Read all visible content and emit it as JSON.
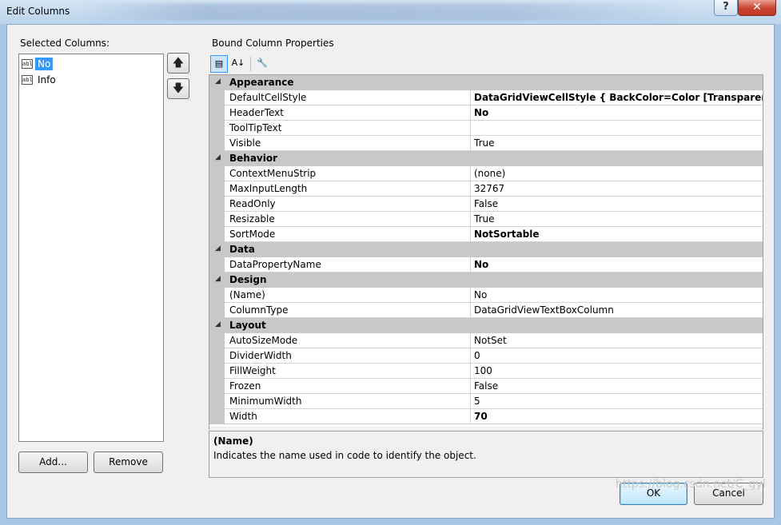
{
  "window": {
    "title": "Edit Columns",
    "help_label": "?",
    "close_label": "✕"
  },
  "left": {
    "label": "Selected Columns:",
    "items": [
      {
        "icon": "abl",
        "label": "No",
        "selected": true
      },
      {
        "icon": "abl",
        "label": "Info",
        "selected": false
      }
    ],
    "up_glyph": "🡅",
    "down_glyph": "🡇",
    "add_label": "Add...",
    "remove_label": "Remove"
  },
  "right": {
    "label": "Bound Column Properties",
    "toolbar": {
      "categorized_glyph": "▤",
      "alpha_glyph": "A↓",
      "props_glyph": "🔧"
    },
    "categories": [
      {
        "name": "Appearance",
        "props": [
          {
            "name": "DefaultCellStyle",
            "value": "DataGridViewCellStyle { BackColor=Color [Transparent] }",
            "bold": true
          },
          {
            "name": "HeaderText",
            "value": "No",
            "bold": true
          },
          {
            "name": "ToolTipText",
            "value": "",
            "bold": false
          },
          {
            "name": "Visible",
            "value": "True",
            "bold": false
          }
        ]
      },
      {
        "name": "Behavior",
        "props": [
          {
            "name": "ContextMenuStrip",
            "value": "(none)",
            "bold": false
          },
          {
            "name": "MaxInputLength",
            "value": "32767",
            "bold": false
          },
          {
            "name": "ReadOnly",
            "value": "False",
            "bold": false
          },
          {
            "name": "Resizable",
            "value": "True",
            "bold": false
          },
          {
            "name": "SortMode",
            "value": "NotSortable",
            "bold": true
          }
        ]
      },
      {
        "name": "Data",
        "props": [
          {
            "name": "DataPropertyName",
            "value": "No",
            "bold": true
          }
        ]
      },
      {
        "name": "Design",
        "props": [
          {
            "name": "(Name)",
            "value": "No",
            "bold": false
          },
          {
            "name": "ColumnType",
            "value": "DataGridViewTextBoxColumn",
            "bold": false
          }
        ]
      },
      {
        "name": "Layout",
        "props": [
          {
            "name": "AutoSizeMode",
            "value": "NotSet",
            "bold": false
          },
          {
            "name": "DividerWidth",
            "value": "0",
            "bold": false
          },
          {
            "name": "FillWeight",
            "value": "100",
            "bold": false
          },
          {
            "name": "Frozen",
            "value": "False",
            "bold": false
          },
          {
            "name": "MinimumWidth",
            "value": "5",
            "bold": false
          },
          {
            "name": "Width",
            "value": "70",
            "bold": true
          }
        ]
      }
    ],
    "description": {
      "title": "(Name)",
      "text": "Indicates the name used in code to identify the object."
    }
  },
  "ok_label": "OK",
  "cancel_label": "Cancel",
  "watermark": "https://blog.csdn.net/C_gyl"
}
